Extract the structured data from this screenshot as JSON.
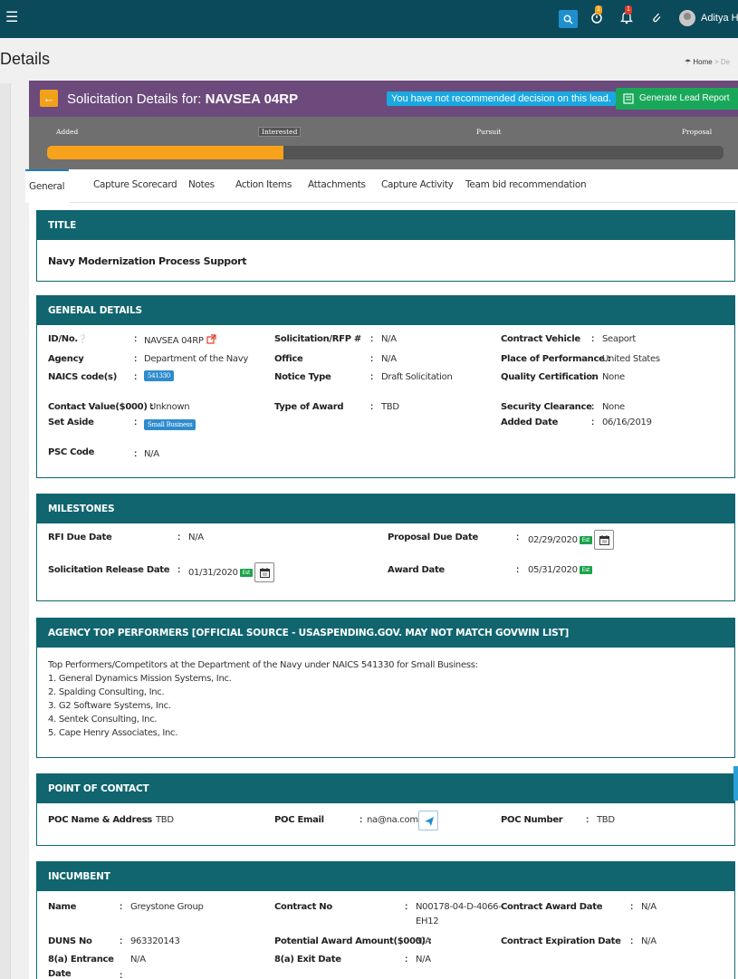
{
  "topbar": {
    "menu_icon": "hamburger-icon",
    "badge_timer": "1",
    "badge_alerts": "1",
    "user_name": "Aditya Har"
  },
  "page": {
    "title": "Details",
    "breadcrumb_home": "Home",
    "breadcrumb_sep": ">",
    "breadcrumb_current": "De"
  },
  "solicitation": {
    "title_prefix": "Solicitation Details for:",
    "title_id": "NAVSEA 04RP",
    "recommend_note": "You have not recommended decision on this lead.",
    "generate_report_label": "Generate Lead Report"
  },
  "pipeline": {
    "stages": [
      "Added",
      "Interested",
      "Pursuit",
      "Proposal"
    ],
    "progress_fraction": 0.35
  },
  "tabs": [
    "General",
    "Capture Scorecard",
    "Notes",
    "Action Items",
    "Attachments",
    "Capture Activity",
    "Team bid recommendation"
  ],
  "title_card": {
    "header": "TITLE",
    "value": "Navy Modernization Process Support"
  },
  "general": {
    "header": "GENERAL DETAILS",
    "id_label": "ID/No.",
    "id_value": "NAVSEA 04RP",
    "agency_label": "Agency",
    "agency_value": "Department of the Navy",
    "naics_label": "NAICS code(s)",
    "naics_value": "541330",
    "contact_value_label": "Contact Value($000) :",
    "contact_value_value": "Unknown",
    "set_aside_label": "Set Aside",
    "set_aside_value": "Small Business",
    "psc_label": "PSC Code",
    "psc_value": "N/A",
    "rfp_label": "Solicitation/RFP #",
    "rfp_value": "N/A",
    "office_label": "Office",
    "office_value": "N/A",
    "notice_label": "Notice Type",
    "notice_value": "Draft Solicitation",
    "award_type_label": "Type of Award",
    "award_type_value": "TBD",
    "vehicle_label": "Contract Vehicle",
    "vehicle_value": "Seaport",
    "pop_label": "Place of Performance :",
    "pop_value": "United States",
    "quality_label": "Quality Certification",
    "quality_value": "None",
    "clearance_label": "Security Clearance",
    "clearance_value": "None",
    "added_label": "Added Date",
    "added_value": "06/16/2019"
  },
  "milestones": {
    "header": "MILESTONES",
    "rfi_label": "RFI Due Date",
    "rfi_value": "N/A",
    "release_label": "Solicitation Release Date",
    "release_value": "01/31/2020",
    "proposal_label": "Proposal Due Date",
    "proposal_value": "02/29/2020",
    "award_label": "Award Date",
    "award_value": "05/31/2020",
    "est_label": "Est"
  },
  "performers": {
    "header": "AGENCY TOP PERFORMERS [OFFICIAL SOURCE - USASPENDING.GOV. MAY NOT MATCH GOVWIN LIST]",
    "intro": "Top Performers/Competitors at the Department of the Navy under NAICS 541330 for Small Business:",
    "items": [
      "1. General Dynamics Mission Systems, Inc.",
      "2. Spalding Consulting, Inc.",
      "3. G2 Software Systems, Inc.",
      "4. Sentek Consulting, Inc.",
      "5. Cape Henry Associates, Inc."
    ]
  },
  "poc": {
    "header": "POINT OF CONTACT",
    "name_label": "POC Name & Address",
    "name_value": "TBD",
    "email_label": "POC Email",
    "email_value": "na@na.com",
    "number_label": "POC Number",
    "number_value": "TBD"
  },
  "incumbent": {
    "header": "INCUMBENT",
    "name_label": "Name",
    "name_value": "Greystone Group",
    "duns_label": "DUNS No",
    "duns_value": "963320143",
    "entrance_label_1": "8(a) Entrance",
    "entrance_label_2": "Date",
    "entrance_value": "N/A",
    "contract_no_label": "Contract No",
    "contract_no_value_1": "N00178-04-D-4066-",
    "contract_no_value_2": "EH12",
    "potential_label": "Potential Award Amount($000) :",
    "potential_value": "N/A",
    "exit_label": "8(a) Exit Date",
    "exit_value": "N/A",
    "award_date_label": "Contract Award Date",
    "award_date_value": "N/A",
    "expiration_label": "Contract Expiration Date",
    "expiration_value": "N/A"
  },
  "colors": {
    "topbar": "#0b4a5a",
    "card_header": "#10656f",
    "solicitation_bar": "#6c4a7b",
    "progress": "#f8a21b",
    "primary": "#1f8fd0",
    "success": "#19a85a"
  }
}
